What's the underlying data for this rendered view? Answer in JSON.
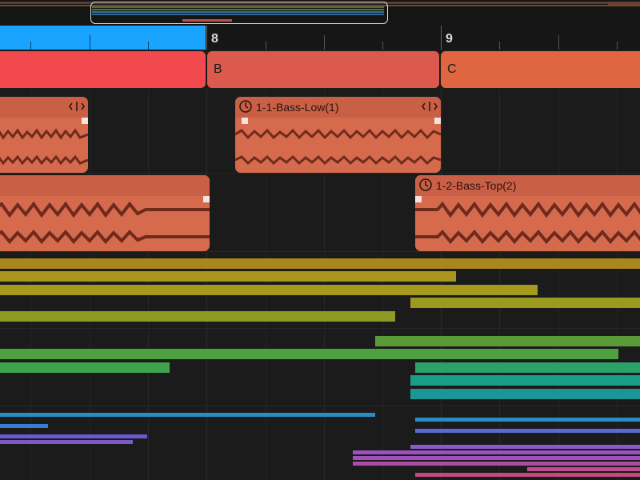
{
  "ruler": {
    "bar_8": "8",
    "bar_9": "9"
  },
  "arrangement": {
    "sections": [
      {
        "label": "",
        "color": "#f2494f"
      },
      {
        "label": "B",
        "color": "#db5a4d"
      },
      {
        "label": "C",
        "color": "#df6641"
      }
    ]
  },
  "regions": {
    "bass_low": {
      "name": "1-1-Bass-Low(1)"
    },
    "bass_top": {
      "name": "1-2-Bass-Top(2)"
    }
  },
  "colors": {
    "accent": "#1aa3ff",
    "region": "#d66a4c",
    "waveform": "#6e2b1c",
    "olive": "#a8961c",
    "green": "#55a03c",
    "teal": "#1a9e8a",
    "blue": "#2b8bc4",
    "purple": "#7a5ac8",
    "violet": "#9a52c0",
    "magenta": "#c04c8c"
  }
}
